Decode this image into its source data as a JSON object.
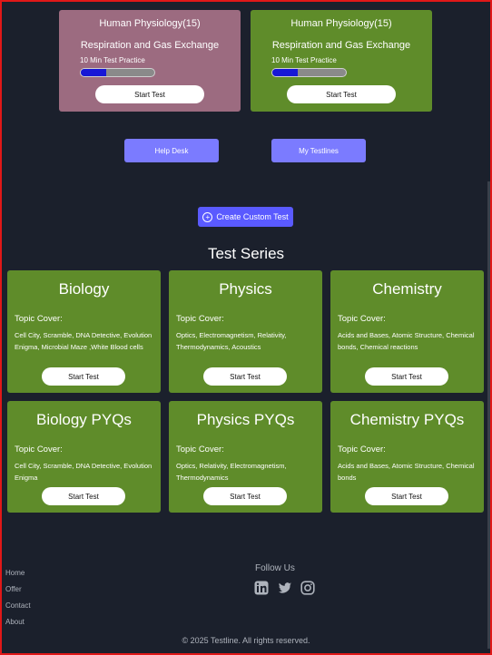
{
  "practice_cards": [
    {
      "title": "Human Physiology(15)",
      "topic": "Respiration and Gas Exchange",
      "subtitle": "10 Min Test Practice",
      "progress": 0.35,
      "button": "Start Test",
      "color": "#9c6b80"
    },
    {
      "title": "Human Physiology(15)",
      "topic": "Respiration and Gas Exchange",
      "subtitle": "10 Min Test Practice",
      "progress": 0.35,
      "button": "Start Test",
      "color": "#5f8c2a"
    }
  ],
  "nav": {
    "help_desk": "Help Desk",
    "my_testlines": "My Testlines"
  },
  "custom_test": {
    "label": "Create Custom Test",
    "icon": "plus-circle-icon"
  },
  "section_title": "Test Series",
  "series": [
    {
      "name": "Biology",
      "cover_label": "Topic Cover:",
      "topics": "Cell City, Scramble, DNA Detective, Evolution Enigma, Microbial Maze ,White Blood cells",
      "button": "Start Test"
    },
    {
      "name": "Physics",
      "cover_label": "Topic Cover:",
      "topics": "Optics, Electromagnetism, Relativity, Thermodynamics, Acoustics",
      "button": "Start Test"
    },
    {
      "name": "Chemistry",
      "cover_label": "Topic Cover:",
      "topics": "Acids and Bases, Atomic Structure, Chemical bonds, Chemical reactions",
      "button": "Start Test"
    },
    {
      "name": "Biology PYQs",
      "cover_label": "Topic Cover:",
      "topics": "Cell City, Scramble, DNA Detective, Evolution Enigma",
      "button": "Start Test"
    },
    {
      "name": "Physics PYQs",
      "cover_label": "Topic Cover:",
      "topics": "Optics, Relativity, Electromagnetism, Thermodynamics",
      "button": "Start Test"
    },
    {
      "name": "Chemistry PYQs",
      "cover_label": "Topic Cover:",
      "topics": "Acids and Bases, Atomic Structure, Chemical bonds",
      "button": "Start Test"
    }
  ],
  "footer": {
    "links": [
      "Home",
      "Offer",
      "Contact",
      "About"
    ],
    "follow_label": "Follow Us",
    "social_icons": [
      "linkedin-icon",
      "twitter-icon",
      "instagram-icon"
    ],
    "copyright": "© 2025 Testline. All rights reserved."
  },
  "colors": {
    "background": "#1b202c",
    "card_green": "#5f8c2a",
    "accent_blue": "#7b7bff",
    "progress_fill": "#1717d6"
  }
}
